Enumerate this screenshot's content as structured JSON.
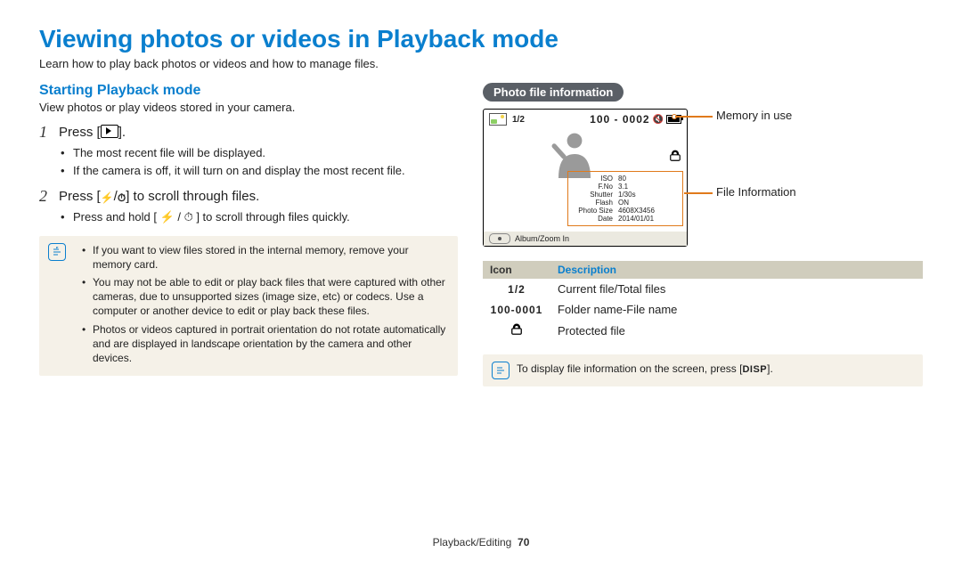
{
  "title": "Viewing photos or videos in Playback mode",
  "lede": "Learn how to play back photos or videos and how to manage files.",
  "left": {
    "section_title": "Starting Playback mode",
    "section_sub": "View photos or play videos stored in your camera.",
    "step1": {
      "num": "1",
      "prefix": "Press [",
      "suffix": "]."
    },
    "step1_bullets": [
      "The most recent file will be displayed.",
      "If the camera is off, it will turn on and display the most recent file."
    ],
    "step2": {
      "num": "2",
      "prefix": "Press [",
      "mid": "/",
      "suffix": "] to scroll through files."
    },
    "step2_bullets": [
      "Press and hold [ ⚡ / ⏱ ] to scroll through files quickly."
    ],
    "note_items": [
      "If you want to view files stored in the internal memory, remove your memory card.",
      "You may not be able to edit or play back files that were captured with other cameras, due to unsupported sizes (image size, etc) or codecs. Use a computer or another device to edit or play back these files.",
      "Photos or videos captured in portrait orientation do not rotate automatically and are displayed in landscape orientation by the camera and other devices."
    ]
  },
  "right": {
    "subhead": "Photo file information",
    "lcd": {
      "counter": "1/2",
      "file_label": "100 - 0002",
      "info": [
        {
          "lbl": "ISO",
          "val": "80"
        },
        {
          "lbl": "F.No",
          "val": "3.1"
        },
        {
          "lbl": "Shutter",
          "val": "1/30s"
        },
        {
          "lbl": "Flash",
          "val": "ON"
        },
        {
          "lbl": "Photo Size",
          "val": "4608X3456"
        },
        {
          "lbl": "Date",
          "val": "2014/01/01"
        }
      ],
      "bottom_label": "Album/Zoom In"
    },
    "callouts": {
      "memory": "Memory in use",
      "fileinfo": "File Information"
    },
    "table": {
      "head_icon": "Icon",
      "head_desc": "Description",
      "rows": [
        {
          "icon": "1/2",
          "icon_class": "key-label",
          "desc": "Current file/Total files"
        },
        {
          "icon": "100-0001",
          "icon_class": "key-label",
          "desc": "Folder name-File name"
        },
        {
          "icon": "lock",
          "icon_class": "lock-cell",
          "desc": "Protected file"
        }
      ]
    },
    "note2_prefix": "To display file information on the screen, press [",
    "note2_disp": "DISP",
    "note2_suffix": "]."
  },
  "footer": {
    "section": "Playback/Editing",
    "page": "70"
  }
}
